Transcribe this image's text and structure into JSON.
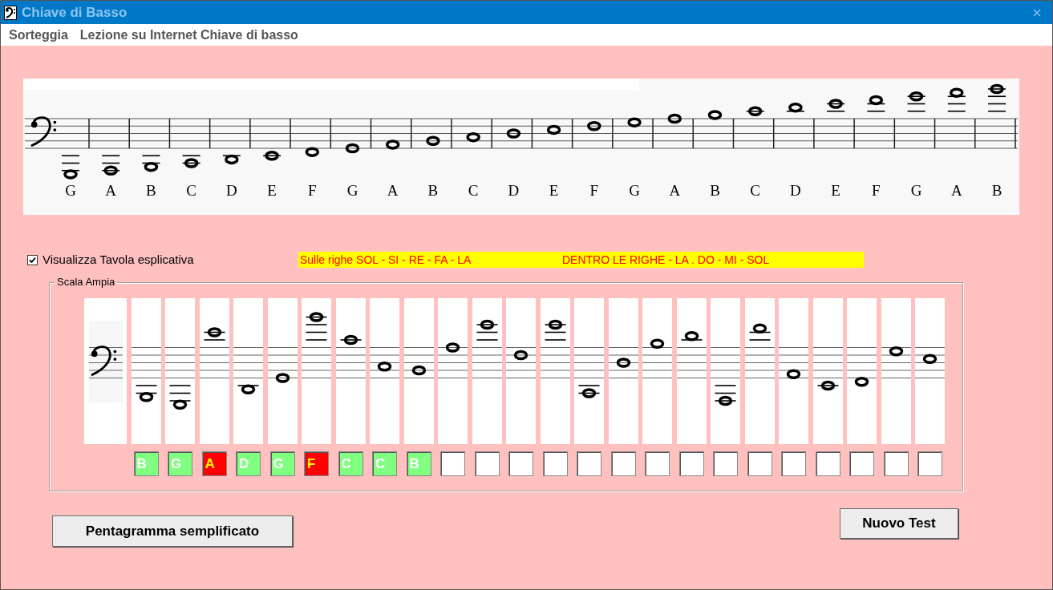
{
  "window": {
    "title": "Chiave di Basso"
  },
  "menu": [
    "Sorteggia",
    "Lezione su Internet Chiave di basso"
  ],
  "reference_staff": {
    "notes": [
      {
        "label": "G"
      },
      {
        "label": "A"
      },
      {
        "label": "B"
      },
      {
        "label": "C"
      },
      {
        "label": "D"
      },
      {
        "label": "E"
      },
      {
        "label": "F"
      },
      {
        "label": "G"
      },
      {
        "label": "A"
      },
      {
        "label": "B"
      },
      {
        "label": "C"
      },
      {
        "label": "D"
      },
      {
        "label": "E"
      },
      {
        "label": "F"
      },
      {
        "label": "G"
      },
      {
        "label": "A"
      },
      {
        "label": "B"
      },
      {
        "label": "C"
      },
      {
        "label": "D"
      },
      {
        "label": "E"
      },
      {
        "label": "F"
      },
      {
        "label": "G"
      },
      {
        "label": "A"
      },
      {
        "label": "B"
      }
    ]
  },
  "show_table": {
    "label": "Visualizza Tavola esplicativa",
    "checked": true
  },
  "hint": [
    "Sulle righe SOL - SI - RE - FA - LA",
    "DENTRO LE RIGHE - LA . DO - MI - SOL"
  ],
  "exercise": {
    "title": "Scala Ampia",
    "answers": [
      {
        "kind": "correct",
        "text": "B"
      },
      {
        "kind": "correct",
        "text": "G"
      },
      {
        "kind": "wrong",
        "text": "A"
      },
      {
        "kind": "correct",
        "text": "D"
      },
      {
        "kind": "correct",
        "text": "G"
      },
      {
        "kind": "wrong",
        "text": "F"
      },
      {
        "kind": "correct",
        "text": "C"
      },
      {
        "kind": "correct",
        "text": "C"
      },
      {
        "kind": "correct",
        "text": "B"
      },
      {
        "kind": "empty"
      },
      {
        "kind": "empty"
      },
      {
        "kind": "empty"
      },
      {
        "kind": "empty"
      },
      {
        "kind": "empty"
      },
      {
        "kind": "empty"
      },
      {
        "kind": "empty"
      },
      {
        "kind": "empty"
      },
      {
        "kind": "empty"
      },
      {
        "kind": "empty"
      },
      {
        "kind": "empty"
      },
      {
        "kind": "empty"
      },
      {
        "kind": "empty"
      },
      {
        "kind": "empty"
      },
      {
        "kind": "empty"
      }
    ]
  },
  "buttons": [
    "Pentagramma semplificato",
    "Nuovo Test"
  ]
}
